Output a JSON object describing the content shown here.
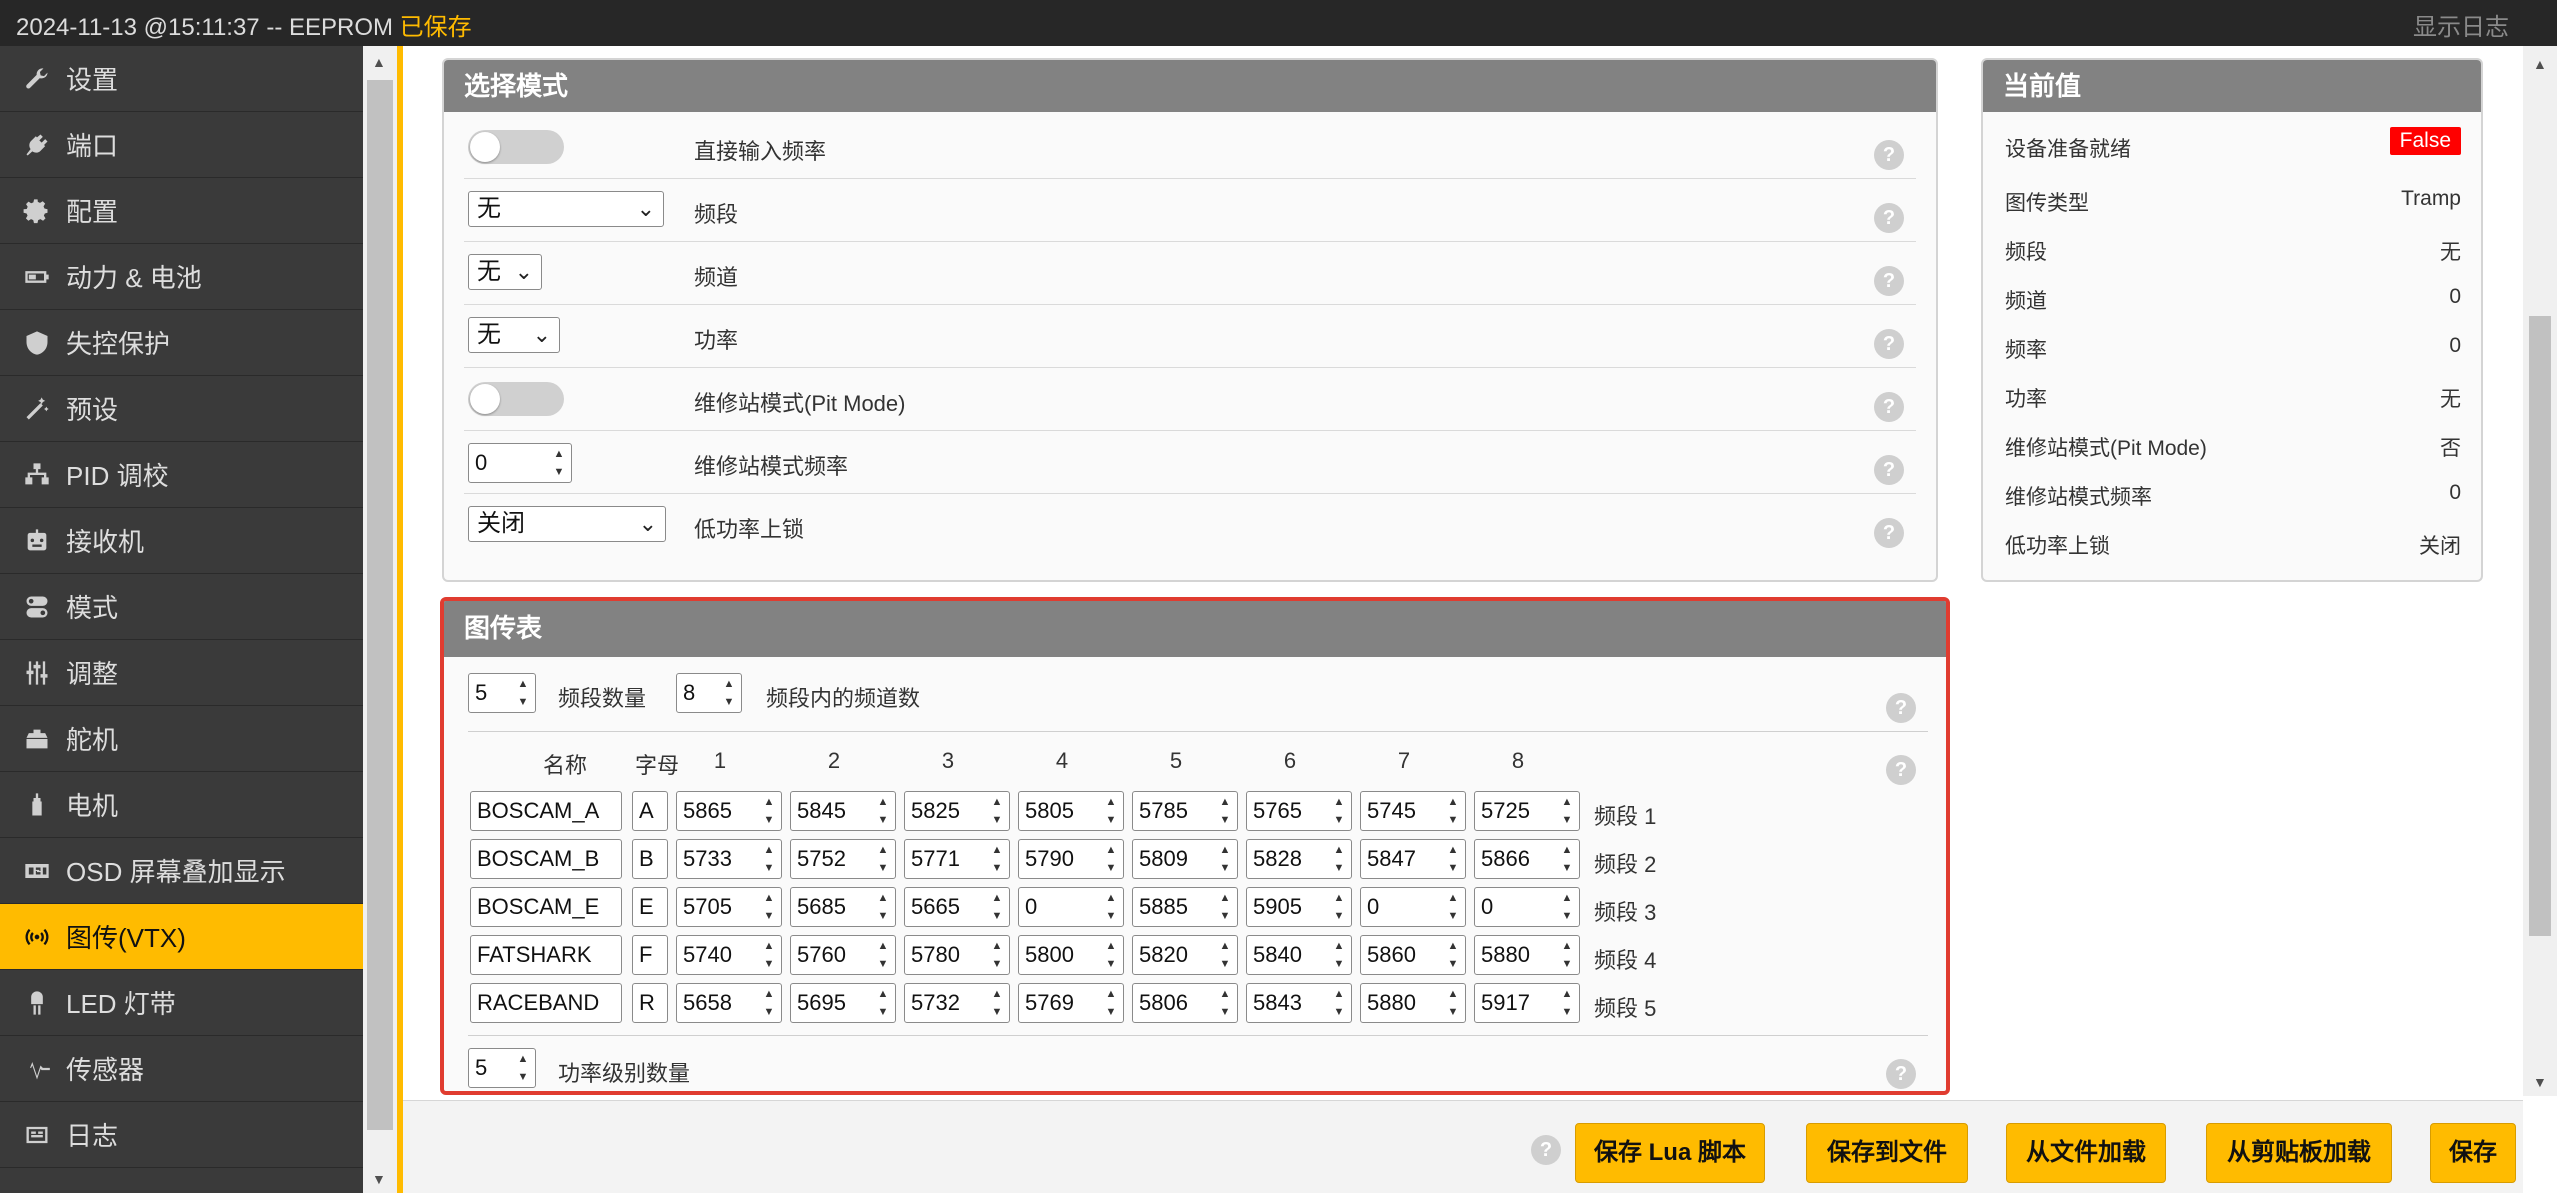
{
  "topbar": {
    "status": "2024-11-13 @15:11:37 -- EEPROM",
    "saved": "已保存",
    "show_log": "显示日志"
  },
  "sidebar": {
    "items": [
      {
        "label": "设置",
        "icon": "wrench-icon"
      },
      {
        "label": "端口",
        "icon": "plug-icon"
      },
      {
        "label": "配置",
        "icon": "gear-icon"
      },
      {
        "label": "动力 & 电池",
        "icon": "battery-icon"
      },
      {
        "label": "失控保护",
        "icon": "shield-icon"
      },
      {
        "label": "预设",
        "icon": "magic-wand-icon"
      },
      {
        "label": "PID 调校",
        "icon": "sitemap-icon"
      },
      {
        "label": "接收机",
        "icon": "robot-icon"
      },
      {
        "label": "模式",
        "icon": "toggle-icon"
      },
      {
        "label": "调整",
        "icon": "sliders-icon"
      },
      {
        "label": "舵机",
        "icon": "servo-icon"
      },
      {
        "label": "电机",
        "icon": "motor-icon"
      },
      {
        "label": "OSD 屏幕叠加显示",
        "icon": "osd-icon"
      },
      {
        "label": "图传(VTX)",
        "icon": "antenna-icon",
        "active": true
      },
      {
        "label": "LED 灯带",
        "icon": "led-icon"
      },
      {
        "label": "传感器",
        "icon": "pulse-icon"
      },
      {
        "label": "日志",
        "icon": "log-icon"
      }
    ]
  },
  "mode_panel": {
    "title": "选择模式",
    "rows": [
      {
        "label": "直接输入频率"
      },
      {
        "label": "频段",
        "value": "无"
      },
      {
        "label": "频道",
        "value": "无"
      },
      {
        "label": "功率",
        "value": "无"
      },
      {
        "label": "维修站模式(Pit Mode)"
      },
      {
        "label": "维修站模式频率",
        "value": "0"
      },
      {
        "label": "低功率上锁",
        "value": "关闭"
      }
    ],
    "help": "?"
  },
  "current_panel": {
    "title": "当前值",
    "rows": [
      {
        "label": "设备准备就绪",
        "value": "False"
      },
      {
        "label": "图传类型",
        "value": "Tramp"
      },
      {
        "label": "频段",
        "value": "无"
      },
      {
        "label": "频道",
        "value": "0"
      },
      {
        "label": "频率",
        "value": "0"
      },
      {
        "label": "功率",
        "value": "无"
      },
      {
        "label": "维修站模式(Pit Mode)",
        "value": "否"
      },
      {
        "label": "维修站模式频率",
        "value": "0"
      },
      {
        "label": "低功率上锁",
        "value": "关闭"
      }
    ]
  },
  "vtx_table": {
    "title": "图传表",
    "band_count": "5",
    "band_count_label": "频段数量",
    "channel_count": "8",
    "channel_count_label": "频段内的频道数",
    "headers": {
      "name": "名称",
      "letter": "字母",
      "channels": [
        "1",
        "2",
        "3",
        "4",
        "5",
        "6",
        "7",
        "8"
      ]
    },
    "bands": [
      {
        "name": "BOSCAM_A",
        "letter": "A",
        "freqs": [
          "5865",
          "5845",
          "5825",
          "5805",
          "5785",
          "5765",
          "5745",
          "5725"
        ],
        "tag": "频段 1"
      },
      {
        "name": "BOSCAM_B",
        "letter": "B",
        "freqs": [
          "5733",
          "5752",
          "5771",
          "5790",
          "5809",
          "5828",
          "5847",
          "5866"
        ],
        "tag": "频段 2"
      },
      {
        "name": "BOSCAM_E",
        "letter": "E",
        "freqs": [
          "5705",
          "5685",
          "5665",
          "0",
          "5885",
          "5905",
          "0",
          "0"
        ],
        "tag": "频段 3"
      },
      {
        "name": "FATSHARK",
        "letter": "F",
        "freqs": [
          "5740",
          "5760",
          "5780",
          "5800",
          "5820",
          "5840",
          "5860",
          "5880"
        ],
        "tag": "频段 4"
      },
      {
        "name": "RACEBAND",
        "letter": "R",
        "freqs": [
          "5658",
          "5695",
          "5732",
          "5769",
          "5806",
          "5843",
          "5880",
          "5917"
        ],
        "tag": "频段 5"
      }
    ],
    "power_levels": "5",
    "power_levels_label": "功率级别数量"
  },
  "toolbar": {
    "buttons": [
      "保存 Lua 脚本",
      "保存到文件",
      "从文件加载",
      "从剪贴板加载",
      "保存"
    ]
  },
  "colors": {
    "accent": "#ffbb00",
    "sidebar": "#3a3a3a",
    "topbar": "#272727",
    "panel_header": "#828282",
    "highlight_border": "#e03c30",
    "false_badge": "#ff0000"
  }
}
